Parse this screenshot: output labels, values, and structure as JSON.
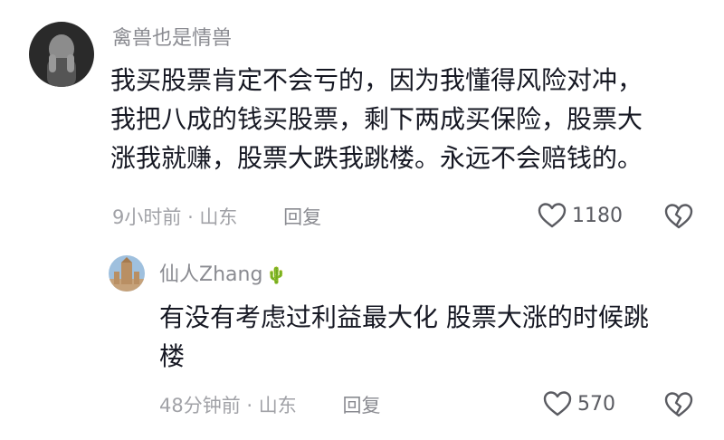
{
  "comments": [
    {
      "username": "禽兽也是情兽",
      "lines": [
        "我买股票肯定不会亏的，因为我懂得风险对冲，",
        "我把八成的钱买股票，剩下两成买保险，股票大",
        "涨我就赚，股票大跌我跳楼。永远不会赔钱的。"
      ],
      "time": "9小时前",
      "location": "山东",
      "reply_label": "回复",
      "likes": "1180"
    },
    {
      "username": "仙人Zhang",
      "username_emoji": "🌵",
      "lines": [
        "有没有考虑过利益最大化 股票大涨的时候跳",
        "楼"
      ],
      "time": "48分钟前",
      "location": "山东",
      "reply_label": "回复",
      "likes": "570"
    }
  ]
}
